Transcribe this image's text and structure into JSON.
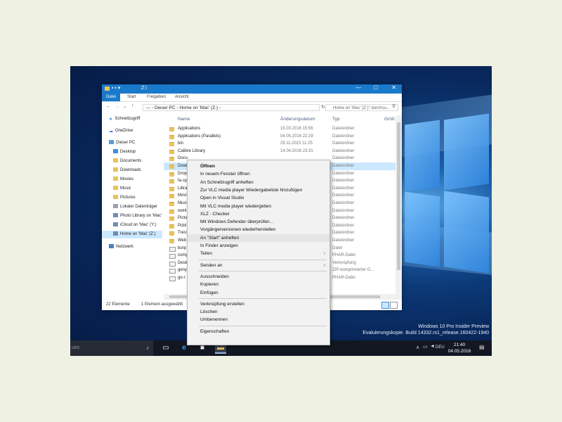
{
  "explorer": {
    "title_path": "Z:\\",
    "ribbon_tabs": [
      "Datei",
      "Start",
      "Freigeben",
      "Ansicht"
    ],
    "address_segments": [
      "Dieser PC",
      "Home on 'Mac' (Z:)"
    ],
    "search_placeholder": "Home on 'Mac' (Z:)\" durchsu...",
    "columns": {
      "name": "Name",
      "date": "Änderungsdatum",
      "type": "Typ",
      "size": "Größ"
    },
    "nav": [
      {
        "label": "Schnellzugriff",
        "icon": "star-icon"
      },
      {
        "label": "OneDrive",
        "icon": "cloud-icon"
      },
      {
        "label": "Dieser PC",
        "icon": "pc-icon"
      },
      {
        "label": "Desktop",
        "icon": "folder-icon"
      },
      {
        "label": "Documents",
        "icon": "folder-icon"
      },
      {
        "label": "Downloads",
        "icon": "folder-icon"
      },
      {
        "label": "Movies",
        "icon": "folder-icon"
      },
      {
        "label": "Music",
        "icon": "folder-icon"
      },
      {
        "label": "Pictures",
        "icon": "folder-icon"
      },
      {
        "label": "Lokaler Datenträger",
        "icon": "drive-icon"
      },
      {
        "label": "Photo Library on 'Mac'",
        "icon": "network-drive-icon"
      },
      {
        "label": "iCloud on 'Mac' (Y:)",
        "icon": "network-drive-icon"
      },
      {
        "label": "Home on 'Mac' (Z:)",
        "icon": "network-drive-icon"
      },
      {
        "label": "Netzwerk",
        "icon": "network-icon"
      }
    ],
    "files": [
      {
        "name": "Applications",
        "date": "15.03.2016 15:56",
        "type": "Dateiordner"
      },
      {
        "name": "Applications (Parallels)",
        "date": "04.05.2016 22:29",
        "type": "Dateiordner"
      },
      {
        "name": "bin",
        "date": "29.11.2015 11:25",
        "type": "Dateiordner"
      },
      {
        "name": "Calibre Library",
        "date": "14.04.2016 23:31",
        "type": "Dateiordner"
      },
      {
        "name": "Docu",
        "date": "",
        "type": "Dateiordner"
      },
      {
        "name": "Down",
        "date": "",
        "type": "Dateiordner"
      },
      {
        "name": "Drop",
        "date": "",
        "type": "Dateiordner"
      },
      {
        "name": "fa-sy",
        "date": "",
        "type": "Dateiordner"
      },
      {
        "name": "Libra",
        "date": "",
        "type": "Dateiordner"
      },
      {
        "name": "Movi",
        "date": "",
        "type": "Dateiordner"
      },
      {
        "name": "Musi",
        "date": "",
        "type": "Dateiordner"
      },
      {
        "name": "ownl",
        "date": "",
        "type": "Dateiordner"
      },
      {
        "name": "Pictu",
        "date": "",
        "type": "Dateiordner"
      },
      {
        "name": "Publ",
        "date": "",
        "type": "Dateiordner"
      },
      {
        "name": "Tress",
        "date": "",
        "type": "Dateiordner"
      },
      {
        "name": "Web",
        "date": "",
        "type": "Dateiordner"
      },
      {
        "name": "burp",
        "date": "",
        "type": "Datei"
      },
      {
        "name": "comp",
        "date": "",
        "type": "PHAR-Datei"
      },
      {
        "name": "Desk",
        "date": "",
        "type": "Verknüpfung"
      },
      {
        "name": "geny",
        "date": "",
        "type": "ZIP-komprimierter O..."
      },
      {
        "name": "go-r",
        "date": "",
        "type": "PHAR-Datei"
      }
    ],
    "status_left": "22 Elemente",
    "status_sel": "1 Element ausgewählt"
  },
  "context_menu": [
    {
      "label": "Öffnen",
      "bold": true
    },
    {
      "label": "In neuem Fenster öffnen"
    },
    {
      "label": "An Schnellzugriff anheften"
    },
    {
      "label": "Zur VLC media player Wiedergabeliste hinzufügen"
    },
    {
      "label": "Open in Visual Studio"
    },
    {
      "label": "Mit VLC media player wiedergeben"
    },
    {
      "label": "XLZ - Checker"
    },
    {
      "label": "Mit Windows Defender überprüfen..."
    },
    {
      "label": "Vorgängerversionen wiederherstellen"
    },
    {
      "label": "An \"Start\" anheften",
      "highlighted": true
    },
    {
      "label": "In Finder anzeigen"
    },
    {
      "label": "Teilen",
      "submenu": true
    },
    {
      "sep": true
    },
    {
      "label": "Senden an",
      "submenu": true
    },
    {
      "sep": true
    },
    {
      "label": "Ausschneiden"
    },
    {
      "label": "Kopieren"
    },
    {
      "label": "Einfügen"
    },
    {
      "sep": true
    },
    {
      "label": "Verknüpfung erstellen"
    },
    {
      "label": "Löschen"
    },
    {
      "label": "Umbenennen"
    },
    {
      "sep": true
    },
    {
      "label": "Eigenschaften"
    }
  ],
  "watermark": {
    "line1": "Windows 10 Pro Insider Preview",
    "line2": "Evaluierungskopie. Build 14332.rs1_release.160422-1940"
  },
  "taskbar": {
    "search_text": "ues",
    "language": "DEU",
    "time": "21:40",
    "date": "04.05.2016"
  }
}
